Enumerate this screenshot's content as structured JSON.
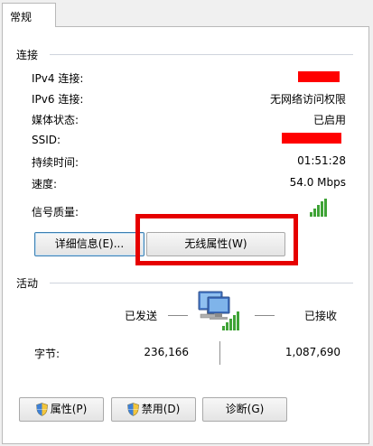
{
  "tab": {
    "label": "常规"
  },
  "connection": {
    "title": "连接",
    "rows": [
      {
        "label": "IPv4 连接:",
        "value": ""
      },
      {
        "label": "IPv6 连接:",
        "value": "无网络访问权限"
      },
      {
        "label": "媒体状态:",
        "value": "已启用"
      },
      {
        "label": "SSID:",
        "value": ""
      },
      {
        "label": "持续时间:",
        "value": "01:51:28"
      },
      {
        "label": "速度:",
        "value": "54.0 Mbps"
      },
      {
        "label": "信号质量:",
        "value": ""
      }
    ]
  },
  "buttons": {
    "details": "详细信息(E)...",
    "wireless_props": "无线属性(W)",
    "properties": "属性(P)",
    "disable": "禁用(D)",
    "diagnose": "诊断(G)"
  },
  "activity": {
    "title": "活动",
    "sent_label": "已发送",
    "received_label": "已接收",
    "bytes_label": "字节:",
    "bytes_sent": "236,166",
    "bytes_received": "1,087,690"
  },
  "colors": {
    "redaction": "#ff0000",
    "annotation_box": "#e60000",
    "signal": "#3fa336"
  },
  "icons": {
    "network": "network-computer-icon",
    "signal": "signal-strength-icon",
    "shield": "uac-shield-icon"
  }
}
